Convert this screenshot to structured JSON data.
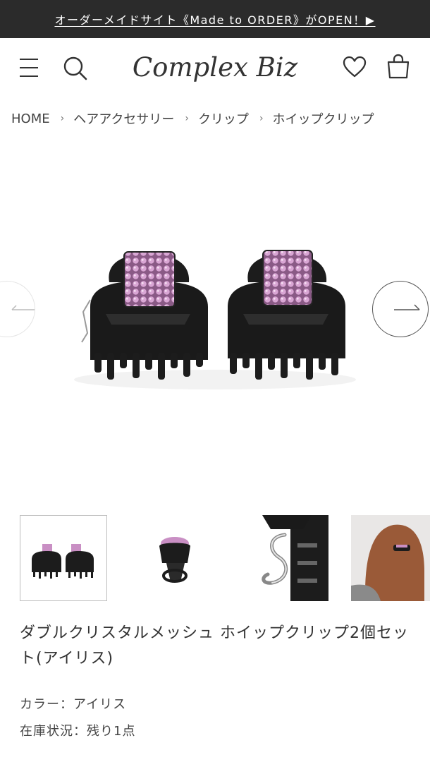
{
  "announcement": {
    "text": "オーダーメイドサイト《Made to ORDER》がOPEN！▶"
  },
  "header": {
    "logo_text": "Complex Biz",
    "menu_icon": "hamburger-icon",
    "search_icon": "search-icon",
    "wishlist_icon": "heart-icon",
    "cart_icon": "shopping-bag-icon"
  },
  "breadcrumb": {
    "items": [
      "HOME",
      "ヘアアクセサリー",
      "クリップ",
      "ホイップクリップ"
    ],
    "separator": "›"
  },
  "gallery": {
    "prev_icon": "arrow-left-icon",
    "next_icon": "arrow-right-icon",
    "main_image": "two-black-claw-clips-with-pink-crystal-mesh",
    "thumbnails": [
      {
        "image": "two-clips-front-view",
        "active": true
      },
      {
        "image": "single-clip-angle-view",
        "active": false
      },
      {
        "image": "clip-charm-closeup",
        "active": false
      },
      {
        "image": "clip-worn-in-hair",
        "active": false
      }
    ]
  },
  "product": {
    "title": "ダブルクリスタルメッシュ ホイップクリップ2個セット(アイリス)",
    "color_label": "カラー：",
    "color_value": "アイリス",
    "stock_label": "在庫状況：",
    "stock_value": "残り1点"
  },
  "colors": {
    "announcement_bg": "#2b2b2b",
    "crystal_pink": "#c98fc4",
    "clip_black": "#1c1c1c"
  }
}
